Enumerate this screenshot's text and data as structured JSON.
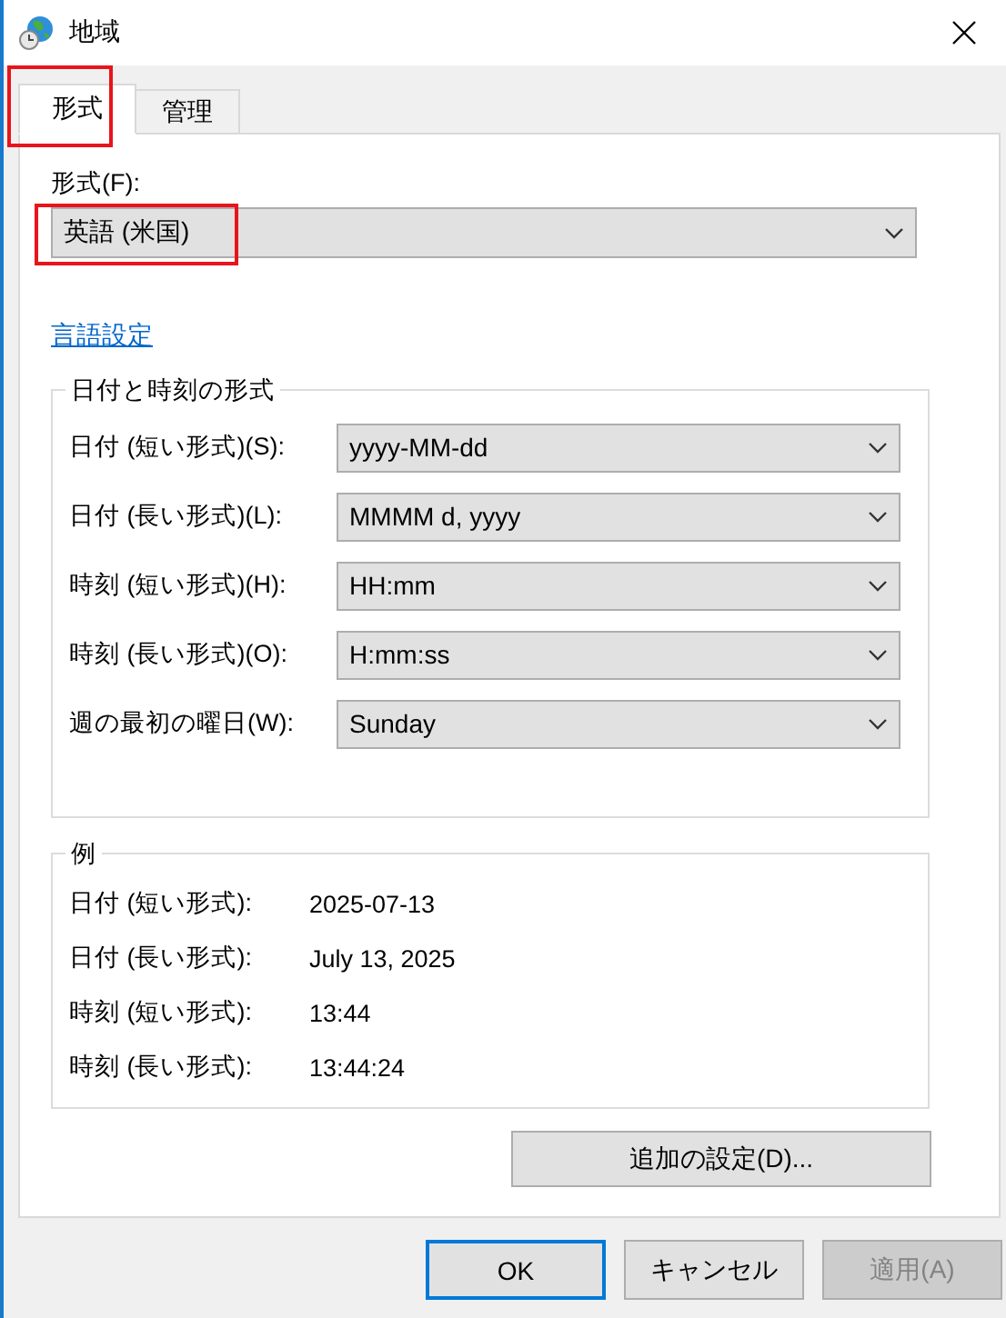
{
  "window": {
    "title": "地域"
  },
  "tabs": [
    {
      "label": "形式",
      "selected": true,
      "highlighted": true
    },
    {
      "label": "管理",
      "selected": false,
      "highlighted": false
    }
  ],
  "format": {
    "label": "形式(F):",
    "value": "英語 (米国)",
    "highlighted": true
  },
  "language_link": "言語設定",
  "datetime_group": {
    "title": "日付と時刻の形式",
    "fields": [
      {
        "label": "日付 (短い形式)(S):",
        "value": "yyyy-MM-dd"
      },
      {
        "label": "日付 (長い形式)(L):",
        "value": "MMMM d, yyyy"
      },
      {
        "label": "時刻 (短い形式)(H):",
        "value": "HH:mm"
      },
      {
        "label": "時刻 (長い形式)(O):",
        "value": "H:mm:ss"
      },
      {
        "label": "週の最初の曜日(W):",
        "value": "Sunday"
      }
    ]
  },
  "example_group": {
    "title": "例",
    "rows": [
      {
        "label": "日付 (短い形式):",
        "value": "2025-07-13"
      },
      {
        "label": "日付 (長い形式):",
        "value": "July 13, 2025"
      },
      {
        "label": "時刻 (短い形式):",
        "value": "13:44"
      },
      {
        "label": "時刻 (長い形式):",
        "value": "13:44:24"
      }
    ]
  },
  "additional_button": "追加の設定(D)...",
  "buttons": [
    {
      "label": "OK",
      "default": true,
      "disabled": false
    },
    {
      "label": "キャンセル",
      "default": false,
      "disabled": false
    },
    {
      "label": "適用(A)",
      "default": false,
      "disabled": true
    }
  ]
}
